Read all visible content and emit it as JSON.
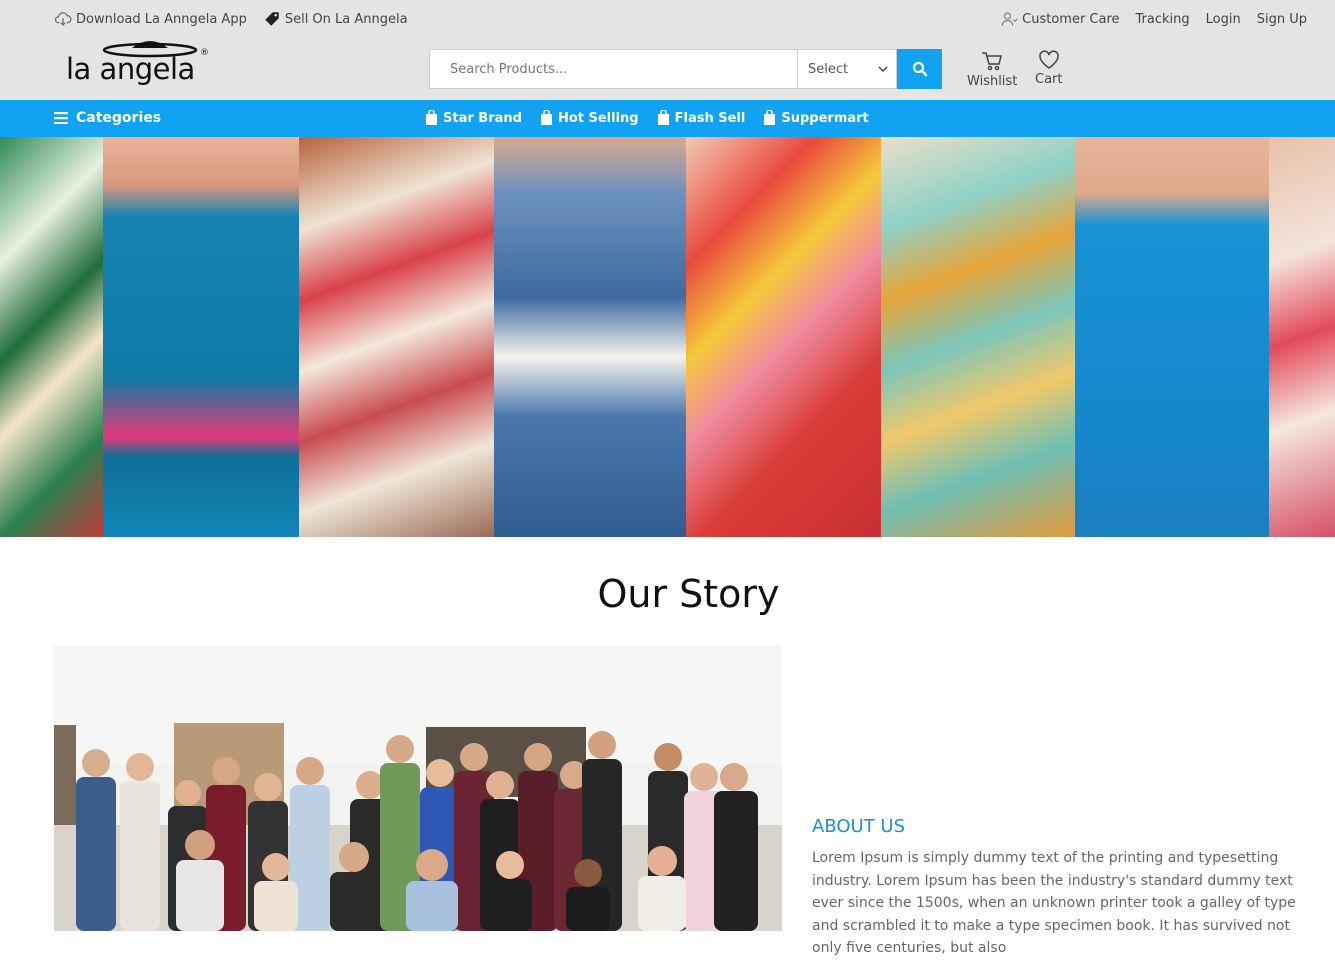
{
  "topbar": {
    "download_app": "Download La Anngela App",
    "sell_on": "Sell On La Anngela",
    "customer_care": "Customer Care",
    "tracking": "Tracking",
    "login": "Login",
    "sign_up": "Sign Up"
  },
  "header": {
    "logo_text": "la angela",
    "logo_reg": "®",
    "search_placeholder": "Search Products...",
    "select_value": "Select",
    "wishlist_label": "Wishlist",
    "cart_label": "Cart"
  },
  "nav": {
    "categories_label": "Categories",
    "links": [
      "Star Brand",
      "Hot Selling",
      "Flash Sell",
      "Suppermart"
    ]
  },
  "story": {
    "title": "Our Story",
    "about_title": "ABOUT US",
    "about_body": "Lorem Ipsum is simply dummy text of the printing and typesetting industry. Lorem Ipsum has been the industry's standard dummy text ever since the 1500s, when an unknown printer took a galley of type and scrambled it to make a type specimen book. It has survived not only five centuries, but also"
  },
  "colors": {
    "accent": "#12a2f2",
    "topbar_bg": "#e4e4e4",
    "about_title": "#1a8fd6"
  }
}
